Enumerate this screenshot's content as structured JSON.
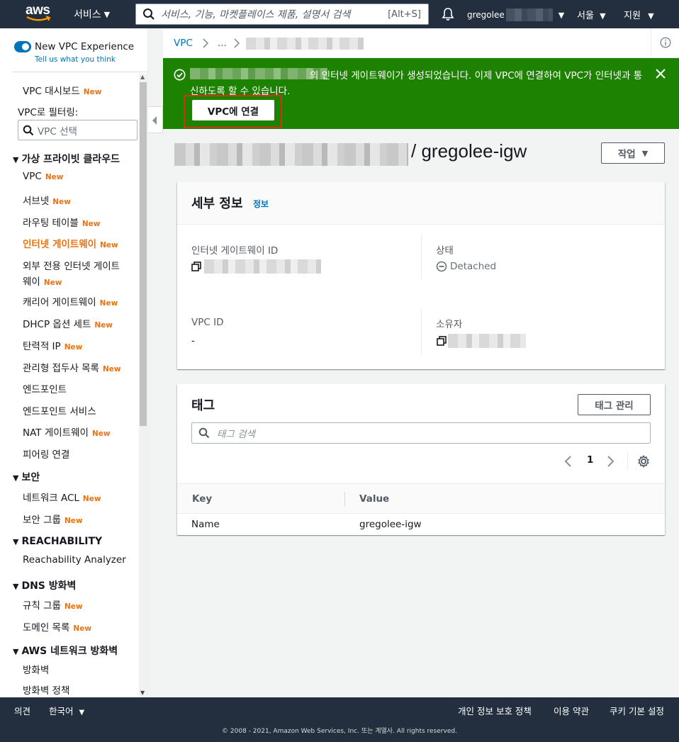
{
  "topnav": {
    "logo": "aws",
    "services_label": "서비스",
    "search_placeholder": "서비스, 기능, 마켓플레이스 제품, 설명서 검색",
    "search_shortcut": "[Alt+S]",
    "user_label": "gregolee",
    "region_label": "서울",
    "support_label": "지원"
  },
  "sidebar": {
    "new_vpc_experience": "New VPC Experience",
    "tell_us": "Tell us what you think",
    "dashboard": "VPC 대시보드",
    "filter_label": "VPC로 필터링:",
    "filter_placeholder": "VPC 선택",
    "new_badge": "New",
    "sections": {
      "virtual_private_cloud": "가상 프라이빗 클라우드",
      "security": "보안",
      "reachability": "REACHABILITY",
      "dns_firewall": "DNS 방화벽",
      "network_firewall": "AWS 네트워크 방화벽"
    },
    "items": {
      "vpc": "VPC",
      "subnets": "서브넷",
      "route_tables": "라우팅 테이블",
      "internet_gateways": "인터넷 게이트웨이",
      "egress_only_line1": "외부 전용 인터넷 게이트",
      "egress_only_line2": "웨이",
      "carrier_gateways": "캐리어 게이트웨이",
      "dhcp_options": "DHCP 옵션 세트",
      "elastic_ip": "탄력적 IP",
      "managed_prefix": "관리형 접두사 목록",
      "endpoints": "엔드포인트",
      "endpoint_services": "엔드포인트 서비스",
      "nat_gateways": "NAT 게이트웨이",
      "peering": "피어링 연결",
      "network_acl": "네트워크 ACL",
      "security_groups": "보안 그룹",
      "reachability_analyzer": "Reachability Analyzer",
      "rule_groups": "규칙 그룹",
      "domain_lists": "도메인 목록",
      "firewalls": "방화벽",
      "firewall_policies": "방화벽 정책"
    }
  },
  "breadcrumb": {
    "vpc": "VPC",
    "ellipsis": "..."
  },
  "flash": {
    "message": "의 인터넷 게이트웨이가 생성되었습니다. 이제 VPC에 연결하여 VPC가 인터넷과 통신하도록 할 수 있습니다.",
    "attach_button": "VPC에 연결"
  },
  "page": {
    "title": "/ gregolee-igw",
    "actions_button": "작업"
  },
  "details": {
    "title": "세부 정보",
    "info_link": "정보",
    "igw_id_label": "인터넷 게이트웨이 ID",
    "state_label": "상태",
    "state_value": "Detached",
    "vpc_id_label": "VPC ID",
    "vpc_id_value": "-",
    "owner_label": "소유자"
  },
  "tags": {
    "title": "태그",
    "manage_button": "태그 관리",
    "search_placeholder": "태그 검색",
    "page_number": "1",
    "columns": {
      "key": "Key",
      "value": "Value"
    },
    "rows": [
      {
        "key": "Name",
        "value": "gregolee-igw"
      }
    ]
  },
  "footer": {
    "feedback": "의견",
    "language": "한국어",
    "privacy": "개인 정보 보호 정책",
    "terms": "이용 약관",
    "cookie": "쿠키 기본 설정",
    "copyright": "© 2008 - 2021, Amazon Web Services, Inc. 또는 계열사. All rights reserved."
  },
  "colors": {
    "nav_bg": "#232f3e",
    "success": "#1d8102",
    "link": "#0073bb",
    "accent_orange": "#ec7211",
    "highlight_red": "#d13212"
  }
}
